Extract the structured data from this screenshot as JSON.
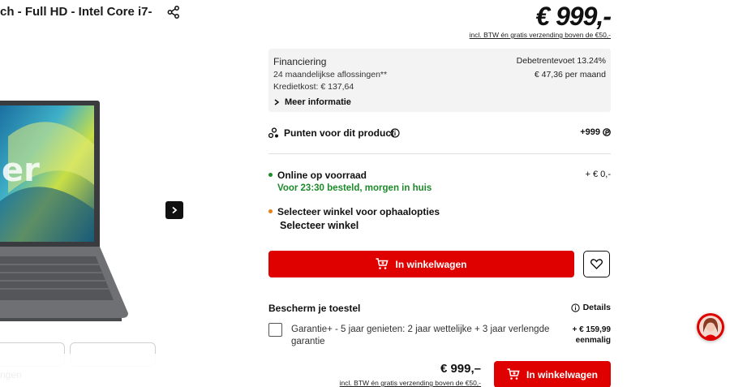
{
  "product": {
    "title": "ch - Full HD - Intel Core i7-"
  },
  "gallery": {
    "bottom_text": "ngen"
  },
  "price": {
    "main": "€ 999,-",
    "note": "incl. BTW én gratis verzending boven de €50,-"
  },
  "financing": {
    "title": "Financiering",
    "rate": "Debetrentevoet 13.24%",
    "installments": "24 maandelijkse aflossingen**",
    "monthly": "€ 47,36 per maand",
    "credit_cost": "Kredietkost: € 137,64",
    "more_label": "Meer informatie"
  },
  "points": {
    "label": "Punten voor dit product",
    "value": "+999"
  },
  "delivery": {
    "online_label": "Online op voorraad",
    "online_price": "+ € 0,-",
    "delivery_text": "Voor 23:30 besteld, morgen in huis",
    "store_label": "Selecteer winkel voor ophaalopties",
    "store_select": "Selecteer winkel"
  },
  "actions": {
    "cart_label": "In winkelwagen"
  },
  "protection": {
    "title": "Bescherm je toestel",
    "details_label": "Details",
    "warranty_text": "Garantie+ - 5 jaar genieten: 2 jaar wettelijke + 3 jaar verlengde garantie",
    "warranty_price": "+ € 159,99",
    "warranty_freq": "eenmalig"
  },
  "sticky": {
    "price": "€ 999,–",
    "note": "incl. BTW én gratis verzending boven de €50,-",
    "cart_label": "In winkelwagen"
  },
  "colors": {
    "brand_red": "#df0000",
    "stock_green": "#1d8a2a",
    "store_orange": "#e8801a"
  }
}
